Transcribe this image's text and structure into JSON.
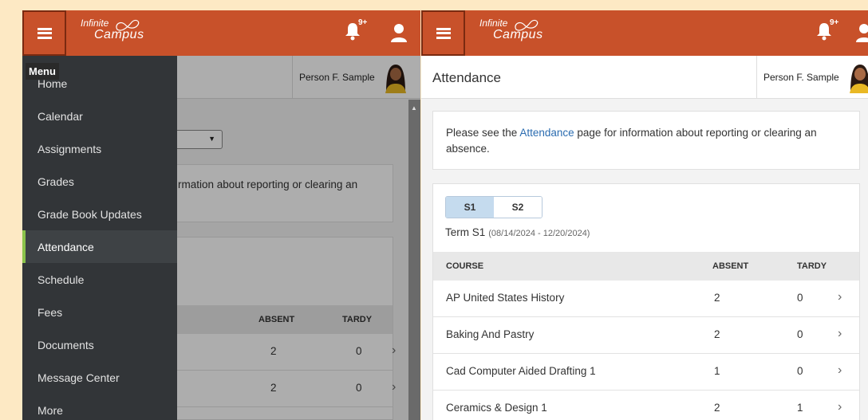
{
  "app": {
    "logo_line1": "Infinite",
    "logo_line2": "Campus",
    "notification_badge": "9+",
    "user_name": "Person F. Sample"
  },
  "left_screen": {
    "menu_tooltip": "Menu",
    "menu_items": [
      {
        "label": "Home"
      },
      {
        "label": "Calendar"
      },
      {
        "label": "Assignments"
      },
      {
        "label": "Grades"
      },
      {
        "label": "Grade Book Updates"
      },
      {
        "label": "Attendance",
        "active": true
      },
      {
        "label": "Schedule"
      },
      {
        "label": "Fees"
      },
      {
        "label": "Documents"
      },
      {
        "label": "Message Center"
      },
      {
        "label": "More"
      }
    ],
    "notice_partial": "rmation about reporting or clearing an",
    "table_headers": {
      "absent": "ABSENT",
      "tardy": "TARDY"
    },
    "rows": [
      {
        "absent": "2",
        "tardy": "0"
      },
      {
        "absent": "2",
        "tardy": "0"
      }
    ]
  },
  "right_screen": {
    "page_title": "Attendance",
    "notice": {
      "before_link": "Please see the ",
      "link": "Attendance",
      "after_link": " page for information about reporting or clearing an absence."
    },
    "term_tabs": [
      {
        "label": "S1",
        "active": true
      },
      {
        "label": "S2",
        "active": false
      }
    ],
    "term_label": "Term S1",
    "term_dates": "(08/14/2024 - 12/20/2024)",
    "table_headers": {
      "course": "COURSE",
      "absent": "ABSENT",
      "tardy": "TARDY"
    },
    "rows": [
      {
        "course": "AP United States History",
        "absent": "2",
        "tardy": "0"
      },
      {
        "course": "Baking And Pastry",
        "absent": "2",
        "tardy": "0"
      },
      {
        "course": "Cad Computer Aided Drafting 1",
        "absent": "1",
        "tardy": "0"
      },
      {
        "course": "Ceramics & Design 1",
        "absent": "2",
        "tardy": "1"
      }
    ]
  },
  "colors": {
    "brand": "#c8512a",
    "menu_bg": "#323538",
    "active_accent": "#8bc34a",
    "link": "#2b6cb0",
    "tab_active": "#c5dbee"
  }
}
